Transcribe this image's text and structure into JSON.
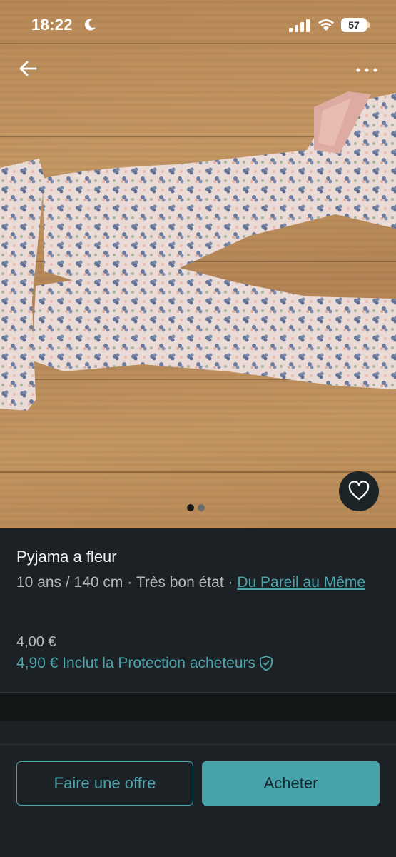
{
  "status_bar": {
    "time": "18:22",
    "battery": "57"
  },
  "icons": {
    "back": "arrow-left-icon",
    "more": "more-horizontal-icon",
    "favorite": "heart-outline-icon",
    "moon": "moon-icon",
    "signal": "cellular-signal-icon",
    "wifi": "wifi-icon",
    "battery": "battery-icon",
    "shield": "shield-check-icon"
  },
  "carousel": {
    "count": 2,
    "active_index": 0
  },
  "item": {
    "title": "Pyjama a fleur",
    "subtitle_prefix": "10 ans / 140 cm · Très bon état · ",
    "brand": "Du Pareil au Même",
    "price": "4,00 €",
    "total_price": "4,90 € Inclut la Protection acheteurs"
  },
  "actions": {
    "offer_label": "Faire une offre",
    "buy_label": "Acheter"
  },
  "colors": {
    "accent": "#4aa5ad",
    "background": "#1b2124"
  }
}
